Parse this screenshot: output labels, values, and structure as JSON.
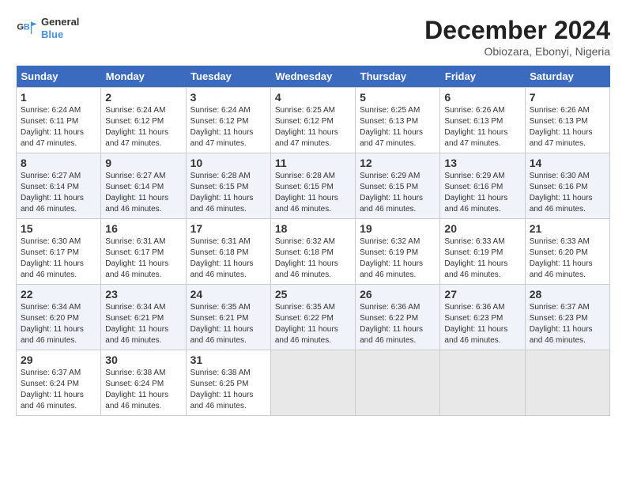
{
  "logo": {
    "line1": "General",
    "line2": "Blue"
  },
  "title": "December 2024",
  "subtitle": "Obiozara, Ebonyi, Nigeria",
  "weekdays": [
    "Sunday",
    "Monday",
    "Tuesday",
    "Wednesday",
    "Thursday",
    "Friday",
    "Saturday"
  ],
  "weeks": [
    [
      {
        "day": "1",
        "info": "Sunrise: 6:24 AM\nSunset: 6:11 PM\nDaylight: 11 hours\nand 47 minutes."
      },
      {
        "day": "2",
        "info": "Sunrise: 6:24 AM\nSunset: 6:12 PM\nDaylight: 11 hours\nand 47 minutes."
      },
      {
        "day": "3",
        "info": "Sunrise: 6:24 AM\nSunset: 6:12 PM\nDaylight: 11 hours\nand 47 minutes."
      },
      {
        "day": "4",
        "info": "Sunrise: 6:25 AM\nSunset: 6:12 PM\nDaylight: 11 hours\nand 47 minutes."
      },
      {
        "day": "5",
        "info": "Sunrise: 6:25 AM\nSunset: 6:13 PM\nDaylight: 11 hours\nand 47 minutes."
      },
      {
        "day": "6",
        "info": "Sunrise: 6:26 AM\nSunset: 6:13 PM\nDaylight: 11 hours\nand 47 minutes."
      },
      {
        "day": "7",
        "info": "Sunrise: 6:26 AM\nSunset: 6:13 PM\nDaylight: 11 hours\nand 47 minutes."
      }
    ],
    [
      {
        "day": "8",
        "info": "Sunrise: 6:27 AM\nSunset: 6:14 PM\nDaylight: 11 hours\nand 46 minutes."
      },
      {
        "day": "9",
        "info": "Sunrise: 6:27 AM\nSunset: 6:14 PM\nDaylight: 11 hours\nand 46 minutes."
      },
      {
        "day": "10",
        "info": "Sunrise: 6:28 AM\nSunset: 6:15 PM\nDaylight: 11 hours\nand 46 minutes."
      },
      {
        "day": "11",
        "info": "Sunrise: 6:28 AM\nSunset: 6:15 PM\nDaylight: 11 hours\nand 46 minutes."
      },
      {
        "day": "12",
        "info": "Sunrise: 6:29 AM\nSunset: 6:15 PM\nDaylight: 11 hours\nand 46 minutes."
      },
      {
        "day": "13",
        "info": "Sunrise: 6:29 AM\nSunset: 6:16 PM\nDaylight: 11 hours\nand 46 minutes."
      },
      {
        "day": "14",
        "info": "Sunrise: 6:30 AM\nSunset: 6:16 PM\nDaylight: 11 hours\nand 46 minutes."
      }
    ],
    [
      {
        "day": "15",
        "info": "Sunrise: 6:30 AM\nSunset: 6:17 PM\nDaylight: 11 hours\nand 46 minutes."
      },
      {
        "day": "16",
        "info": "Sunrise: 6:31 AM\nSunset: 6:17 PM\nDaylight: 11 hours\nand 46 minutes."
      },
      {
        "day": "17",
        "info": "Sunrise: 6:31 AM\nSunset: 6:18 PM\nDaylight: 11 hours\nand 46 minutes."
      },
      {
        "day": "18",
        "info": "Sunrise: 6:32 AM\nSunset: 6:18 PM\nDaylight: 11 hours\nand 46 minutes."
      },
      {
        "day": "19",
        "info": "Sunrise: 6:32 AM\nSunset: 6:19 PM\nDaylight: 11 hours\nand 46 minutes."
      },
      {
        "day": "20",
        "info": "Sunrise: 6:33 AM\nSunset: 6:19 PM\nDaylight: 11 hours\nand 46 minutes."
      },
      {
        "day": "21",
        "info": "Sunrise: 6:33 AM\nSunset: 6:20 PM\nDaylight: 11 hours\nand 46 minutes."
      }
    ],
    [
      {
        "day": "22",
        "info": "Sunrise: 6:34 AM\nSunset: 6:20 PM\nDaylight: 11 hours\nand 46 minutes."
      },
      {
        "day": "23",
        "info": "Sunrise: 6:34 AM\nSunset: 6:21 PM\nDaylight: 11 hours\nand 46 minutes."
      },
      {
        "day": "24",
        "info": "Sunrise: 6:35 AM\nSunset: 6:21 PM\nDaylight: 11 hours\nand 46 minutes."
      },
      {
        "day": "25",
        "info": "Sunrise: 6:35 AM\nSunset: 6:22 PM\nDaylight: 11 hours\nand 46 minutes."
      },
      {
        "day": "26",
        "info": "Sunrise: 6:36 AM\nSunset: 6:22 PM\nDaylight: 11 hours\nand 46 minutes."
      },
      {
        "day": "27",
        "info": "Sunrise: 6:36 AM\nSunset: 6:23 PM\nDaylight: 11 hours\nand 46 minutes."
      },
      {
        "day": "28",
        "info": "Sunrise: 6:37 AM\nSunset: 6:23 PM\nDaylight: 11 hours\nand 46 minutes."
      }
    ],
    [
      {
        "day": "29",
        "info": "Sunrise: 6:37 AM\nSunset: 6:24 PM\nDaylight: 11 hours\nand 46 minutes."
      },
      {
        "day": "30",
        "info": "Sunrise: 6:38 AM\nSunset: 6:24 PM\nDaylight: 11 hours\nand 46 minutes."
      },
      {
        "day": "31",
        "info": "Sunrise: 6:38 AM\nSunset: 6:25 PM\nDaylight: 11 hours\nand 46 minutes."
      },
      {
        "day": "",
        "info": ""
      },
      {
        "day": "",
        "info": ""
      },
      {
        "day": "",
        "info": ""
      },
      {
        "day": "",
        "info": ""
      }
    ]
  ]
}
